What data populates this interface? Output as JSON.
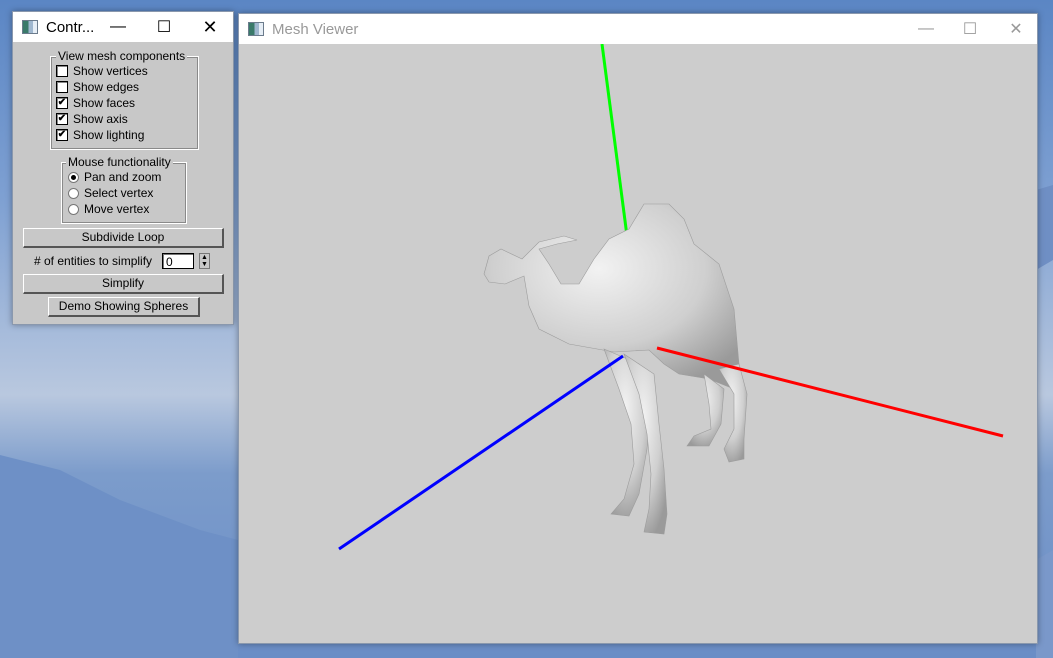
{
  "control_window": {
    "title": "Contr...",
    "minimize_icon": "minimize-icon",
    "maximize_icon": "maximize-icon",
    "close_icon": "close-icon",
    "view_group": {
      "label": "View mesh components",
      "items": [
        {
          "label": "Show vertices",
          "checked": false
        },
        {
          "label": "Show edges",
          "checked": false
        },
        {
          "label": "Show faces",
          "checked": true
        },
        {
          "label": "Show axis",
          "checked": true
        },
        {
          "label": "Show lighting",
          "checked": true
        }
      ]
    },
    "mouse_group": {
      "label": "Mouse functionality",
      "options": [
        {
          "label": "Pan and zoom",
          "selected": true
        },
        {
          "label": "Select vertex",
          "selected": false
        },
        {
          "label": "Move vertex",
          "selected": false
        }
      ]
    },
    "subdivide_label": "Subdivide Loop",
    "entities_label": "# of entities to simplify",
    "entities_value": "0",
    "simplify_label": "Simplify",
    "demo_label": "Demo Showing Spheres",
    "check_mark": "✔"
  },
  "viewer_window": {
    "title": "Mesh Viewer",
    "minimize_glyph": "—",
    "maximize_glyph": "☐",
    "close_glyph": "✕",
    "axis_colors": {
      "x": "#ff0000",
      "y": "#00ff00",
      "z": "#0000ff"
    },
    "model": "camel"
  }
}
